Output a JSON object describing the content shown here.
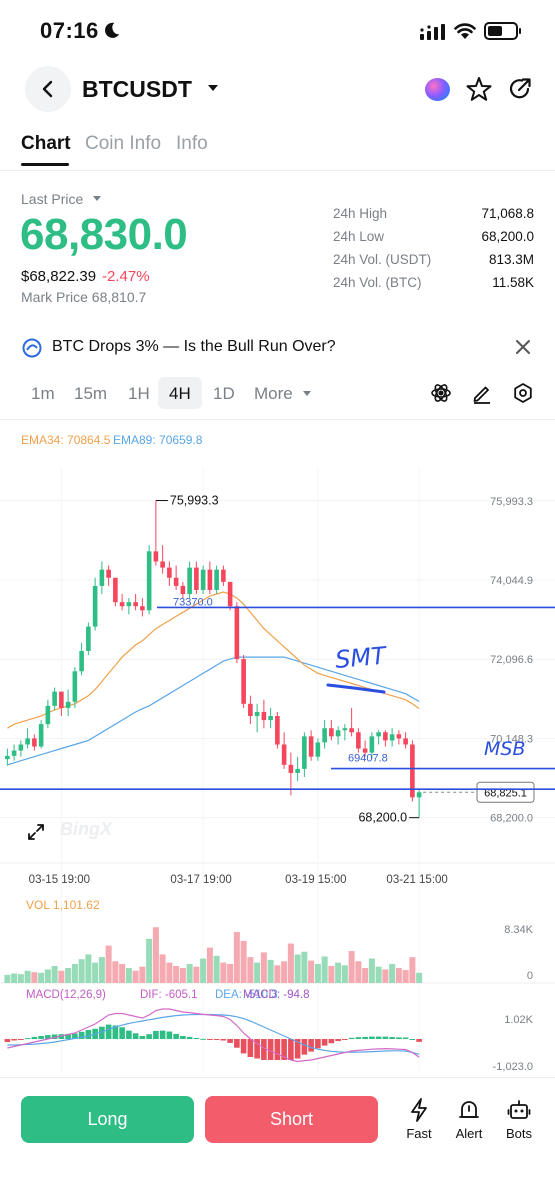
{
  "status_bar": {
    "time": "07:16"
  },
  "header": {
    "pair": "BTCUSDT"
  },
  "tabs": [
    {
      "label": "Chart"
    },
    {
      "label": "Coin Info"
    },
    {
      "label": "Info"
    }
  ],
  "price": {
    "last_price_label": "Last Price",
    "last_price": "68,830.0",
    "usd_price": "$68,822.39",
    "change_pct": "-2.47%",
    "mark_price": "Mark Price 68,810.7",
    "up_color": "#2ebd85",
    "down_color": "#f6465d"
  },
  "stats": [
    {
      "label": "24h High",
      "value": "71,068.8"
    },
    {
      "label": "24h Low",
      "value": "68,200.0"
    },
    {
      "label": "24h Vol. (USDT)",
      "value": "813.3M"
    },
    {
      "label": "24h Vol. (BTC)",
      "value": "11.58K"
    }
  ],
  "news": {
    "text": "BTC Drops 3% — Is the Bull Run Over?"
  },
  "intervals": {
    "items": [
      "1m",
      "15m",
      "1H",
      "4H",
      "1D",
      "More"
    ],
    "selected": "4H"
  },
  "chart_data": {
    "type": "candlestick",
    "indicators": {
      "ema34_label": "EMA34: 70864.5",
      "ema89_label": "EMA89: 70659.8"
    },
    "y_axis_labels": [
      "75,993.3",
      "74,044.9",
      "72,096.6",
      "70,148.3",
      "68,200.0"
    ],
    "ylim": [
      67700,
      76800
    ],
    "x_axis_labels": [
      "03-15 19:00",
      "03-17 19:00",
      "03-19 15:00",
      "03-21 15:00"
    ],
    "high_marker": "75,993.3",
    "low_marker": "68,200.0",
    "current_price_tag": "68,825.1",
    "annotations": {
      "line1_value": "73370.0",
      "line2_value": "69407.8",
      "smt_text": "SMT",
      "msb_text": "MSB"
    },
    "candles": [
      [
        69640,
        69900,
        69480,
        69720
      ],
      [
        69720,
        70000,
        69600,
        69850
      ],
      [
        69850,
        70100,
        69700,
        70000
      ],
      [
        70000,
        70400,
        69900,
        70150
      ],
      [
        70150,
        70250,
        69850,
        69950
      ],
      [
        69950,
        70600,
        69900,
        70500
      ],
      [
        70500,
        71100,
        70400,
        70950
      ],
      [
        70950,
        71400,
        70850,
        71300
      ],
      [
        71300,
        71250,
        70700,
        70900
      ],
      [
        70900,
        71350,
        70700,
        71050
      ],
      [
        71050,
        71900,
        70900,
        71800
      ],
      [
        71800,
        72500,
        71700,
        72300
      ],
      [
        72300,
        73000,
        72200,
        72900
      ],
      [
        72900,
        74100,
        72800,
        73900
      ],
      [
        73900,
        74500,
        73700,
        74300
      ],
      [
        74300,
        74400,
        73900,
        74100
      ],
      [
        74100,
        73800,
        73400,
        73500
      ],
      [
        73500,
        73700,
        73300,
        73400
      ],
      [
        73400,
        73600,
        73200,
        73500
      ],
      [
        73500,
        73700,
        73300,
        73400
      ],
      [
        73400,
        73600,
        73150,
        73300
      ],
      [
        73300,
        74900,
        73200,
        74750
      ],
      [
        74750,
        76000,
        74400,
        74500
      ],
      [
        74500,
        74900,
        74200,
        74350
      ],
      [
        74350,
        74500,
        73900,
        74100
      ],
      [
        74100,
        74400,
        73800,
        73900
      ],
      [
        73900,
        74000,
        73600,
        73700
      ],
      [
        73700,
        74500,
        73600,
        74350
      ],
      [
        74350,
        74500,
        73700,
        73800
      ],
      [
        73800,
        74400,
        73700,
        74300
      ],
      [
        74300,
        74500,
        73700,
        73800
      ],
      [
        73800,
        74400,
        73700,
        74300
      ],
      [
        74300,
        74400,
        73900,
        74000
      ],
      [
        74000,
        73900,
        73300,
        73400
      ],
      [
        73400,
        73500,
        72000,
        72100
      ],
      [
        72100,
        72200,
        70900,
        71000
      ],
      [
        71000,
        71200,
        70500,
        70700
      ],
      [
        70700,
        71000,
        70300,
        70800
      ],
      [
        70800,
        71100,
        70400,
        70600
      ],
      [
        70600,
        70900,
        70400,
        70700
      ],
      [
        70700,
        70800,
        69900,
        70000
      ],
      [
        70000,
        70300,
        69400,
        69500
      ],
      [
        69500,
        69800,
        68750,
        69300
      ],
      [
        69300,
        69700,
        69100,
        69400
      ],
      [
        69400,
        70300,
        69200,
        70200
      ],
      [
        70200,
        70350,
        69600,
        69700
      ],
      [
        69700,
        70150,
        69600,
        70050
      ],
      [
        70050,
        70600,
        69900,
        70400
      ],
      [
        70400,
        70600,
        70100,
        70200
      ],
      [
        70200,
        70450,
        70000,
        70350
      ],
      [
        70350,
        70500,
        70100,
        70400
      ],
      [
        70400,
        70900,
        70200,
        70300
      ],
      [
        70300,
        70400,
        69800,
        69900
      ],
      [
        69900,
        70100,
        69700,
        69800
      ],
      [
        69800,
        70300,
        69650,
        70200
      ],
      [
        70200,
        70350,
        70000,
        70300
      ],
      [
        70300,
        70350,
        69950,
        70100
      ],
      [
        70100,
        70400,
        69950,
        70250
      ],
      [
        70250,
        70350,
        70000,
        70150
      ],
      [
        70150,
        70300,
        69900,
        70000
      ],
      [
        70000,
        70100,
        68600,
        68700
      ],
      [
        68700,
        68900,
        68200,
        68825
      ]
    ],
    "ema_fast": [
      70400,
      70500,
      70550,
      70600,
      70650,
      70700,
      70780,
      70850,
      70900,
      70950,
      71000,
      71100,
      71200,
      71350,
      71550,
      71750,
      71950,
      72150,
      72300,
      72450,
      72550,
      72700,
      72850,
      72950,
      73050,
      73150,
      73250,
      73350,
      73450,
      73550,
      73650,
      73700,
      73750,
      73700,
      73600,
      73450,
      73250,
      73050,
      72850,
      72700,
      72550,
      72400,
      72250,
      72100,
      71950,
      71850,
      71750,
      71700,
      71650,
      71600,
      71550,
      71500,
      71450,
      71400,
      71350,
      71300,
      71250,
      71200,
      71150,
      71100,
      71000,
      70880
    ],
    "ema_slow": [
      69500,
      69550,
      69600,
      69650,
      69700,
      69750,
      69800,
      69850,
      69900,
      69950,
      70000,
      70050,
      70100,
      70200,
      70300,
      70400,
      70500,
      70600,
      70700,
      70800,
      70880,
      70950,
      71050,
      71150,
      71250,
      71350,
      71450,
      71550,
      71650,
      71750,
      71850,
      71950,
      72050,
      72100,
      72150,
      72150,
      72150,
      72150,
      72150,
      72150,
      72150,
      72150,
      72100,
      72050,
      72000,
      71950,
      71900,
      71850,
      71800,
      71750,
      71700,
      71650,
      71600,
      71550,
      71500,
      71450,
      71400,
      71350,
      71300,
      71250,
      71150,
      71060
    ],
    "volume": {
      "label": "VOL 1,101.62",
      "axis_labels": [
        "8.34K",
        "0"
      ],
      "max": 10000,
      "values": [
        1200,
        1400,
        1300,
        1800,
        1600,
        1500,
        2000,
        2500,
        1800,
        2200,
        2800,
        3500,
        4200,
        3000,
        3800,
        5500,
        3200,
        2800,
        2200,
        1800,
        2400,
        6500,
        8200,
        4200,
        3000,
        2500,
        2200,
        2800,
        2400,
        3600,
        5200,
        4000,
        3000,
        2800,
        7500,
        6200,
        3800,
        3000,
        4500,
        3400,
        2600,
        3200,
        5800,
        4200,
        4600,
        3300,
        2800,
        3900,
        2500,
        3000,
        2600,
        4700,
        3200,
        2200,
        3600,
        2400,
        2000,
        2800,
        2200,
        1900,
        3800,
        1500
      ]
    },
    "macd": {
      "title": "MACD(12,26,9)",
      "dif_label": "DIF: -605.1",
      "dea_label": "DEA: -510.3",
      "macd_label": "MACD: -94.8",
      "axis_labels": [
        "1.02K",
        "-1,023.0"
      ],
      "ylim": [
        -1200,
        1200
      ],
      "dif": [
        -300,
        -250,
        -200,
        -150,
        -100,
        -50,
        0,
        50,
        100,
        150,
        200,
        300,
        400,
        500,
        650,
        800,
        850,
        850,
        800,
        750,
        700,
        800,
        950,
        1000,
        1000,
        950,
        900,
        880,
        850,
        820,
        800,
        780,
        750,
        650,
        450,
        200,
        0,
        -150,
        -300,
        -400,
        -500,
        -600,
        -700,
        -750,
        -720,
        -700,
        -650,
        -600,
        -550,
        -500,
        -450,
        -400,
        -380,
        -360,
        -340,
        -330,
        -320,
        -330,
        -340,
        -350,
        -450,
        -605
      ],
      "dea": [
        -200,
        -200,
        -190,
        -180,
        -170,
        -150,
        -130,
        -100,
        -60,
        -20,
        20,
        60,
        100,
        160,
        240,
        320,
        400,
        460,
        520,
        560,
        600,
        640,
        680,
        720,
        750,
        780,
        800,
        810,
        815,
        815,
        815,
        810,
        800,
        780,
        740,
        680,
        600,
        500,
        400,
        300,
        200,
        100,
        0,
        -100,
        -200,
        -280,
        -340,
        -380,
        -410,
        -430,
        -440,
        -440,
        -440,
        -430,
        -420,
        -410,
        -400,
        -395,
        -395,
        -400,
        -450,
        -510
      ],
      "hist": [
        -100,
        -50,
        -10,
        30,
        70,
        100,
        130,
        150,
        160,
        170,
        180,
        240,
        300,
        340,
        410,
        480,
        450,
        390,
        280,
        190,
        100,
        160,
        270,
        280,
        250,
        170,
        100,
        70,
        35,
        5,
        -15,
        -30,
        -50,
        -130,
        -290,
        -480,
        -600,
        -650,
        -700,
        -700,
        -700,
        -700,
        -700,
        -650,
        -520,
        -420,
        -310,
        -220,
        -140,
        -70,
        -10,
        40,
        60,
        70,
        80,
        80,
        80,
        65,
        55,
        50,
        0,
        -95
      ]
    }
  },
  "watermark": "BingX",
  "actions": {
    "long_label": "Long",
    "short_label": "Short",
    "fast_label": "Fast",
    "alert_label": "Alert",
    "bots_label": "Bots"
  }
}
